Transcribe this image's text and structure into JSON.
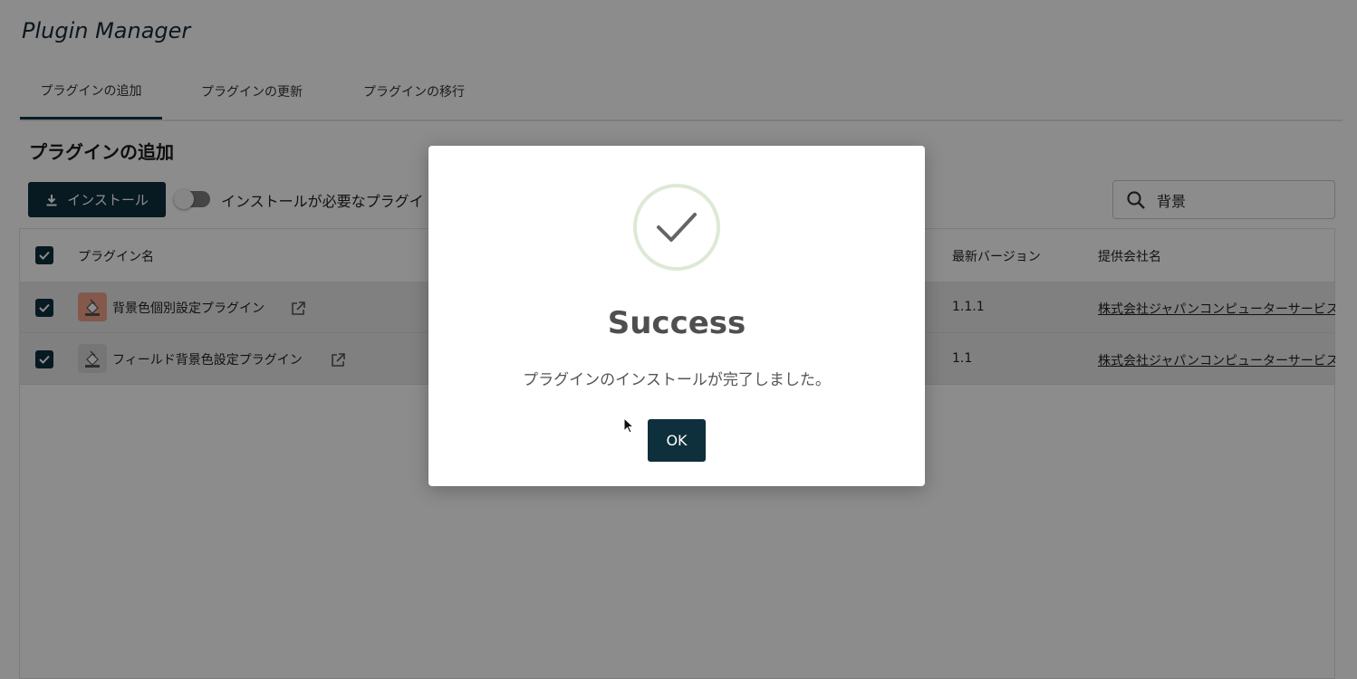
{
  "app": {
    "title": "Plugin Manager"
  },
  "tabs": [
    {
      "label": "プラグインの追加",
      "active": true
    },
    {
      "label": "プラグインの更新",
      "active": false
    },
    {
      "label": "プラグインの移行",
      "active": false
    }
  ],
  "section_title": "プラグインの追加",
  "toolbar": {
    "install_label": "インストール",
    "toggle_label": "インストールが必要なプラグイ",
    "toggle_on": false
  },
  "search": {
    "value": "背景",
    "icon": "search-icon"
  },
  "table": {
    "columns": {
      "name": "プラグイン名",
      "latest_version": "最新バージョン",
      "vendor": "提供会社名"
    },
    "rows": [
      {
        "name": "背景色個別設定プラグイン",
        "icon_color": "#f0a38b",
        "latest_version": "1.1.1",
        "vendor": "株式会社ジャパンコンピューターサービス",
        "checked": true
      },
      {
        "name": "フィールド背景色設定プラグイン",
        "icon_color": "#d8d8d8",
        "latest_version": "1.1",
        "vendor": "株式会社ジャパンコンピューターサービス",
        "checked": true
      }
    ]
  },
  "modal": {
    "title": "Success",
    "message": "プラグインのインストールが完了しました。",
    "ok_label": "OK",
    "icon": "check-circle-icon"
  },
  "colors": {
    "primary": "#0e2f3c",
    "overlay": "rgba(0,0,0,0.45)",
    "success_ring": "#dde9d6"
  }
}
